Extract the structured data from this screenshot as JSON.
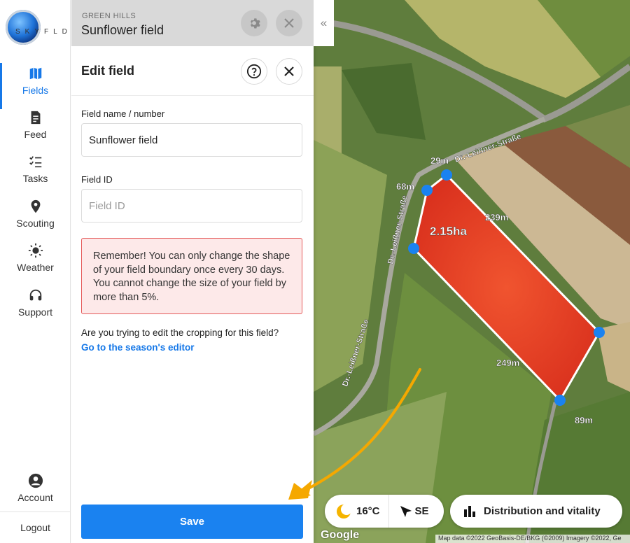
{
  "brand": {
    "logo_text": "SKYFLD"
  },
  "nav": {
    "items": [
      {
        "label": "Fields",
        "icon": "map-icon",
        "active": true
      },
      {
        "label": "Feed",
        "icon": "feed-icon"
      },
      {
        "label": "Tasks",
        "icon": "tasks-icon"
      },
      {
        "label": "Scouting",
        "icon": "pin-icon"
      },
      {
        "label": "Weather",
        "icon": "sun-icon"
      },
      {
        "label": "Support",
        "icon": "headset-icon"
      }
    ],
    "account_label": "Account",
    "logout_label": "Logout"
  },
  "header": {
    "subtitle": "GREEN HILLS",
    "title": "Sunflower field"
  },
  "editor": {
    "title": "Edit field",
    "field_name_label": "Field name / number",
    "field_name_value": "Sunflower field",
    "field_id_label": "Field ID",
    "field_id_placeholder": "Field ID",
    "warning": "Remember! You can only change the shape of your field boundary once every 30 days. You cannot change the size of your field by more than 5%.",
    "cropping_question": "Are you trying to edit the cropping for this field?",
    "season_link": "Go to the season's editor",
    "save_label": "Save"
  },
  "map": {
    "area_label": "2.15ha",
    "edge_labels": [
      "29m",
      "68m",
      "239m",
      "249m",
      "89m"
    ],
    "road_label_1": "Dr.-Leißner-Straße",
    "road_label_2": "Dr.-Leißner-Straße",
    "road_label_3": "Dr.-Leißner-Straße",
    "weather": {
      "temperature": "16°C",
      "wind": "SE"
    },
    "distribution_label": "Distribution and vitality",
    "google_label": "Google",
    "attribution": "Map data ©2022 GeoBasis-DE/BKG (©2009) Imagery ©2022, Ge",
    "colors": {
      "field_fill": "#e8452a",
      "vertex": "#1a82f0",
      "arrow": "#f5a800"
    }
  }
}
